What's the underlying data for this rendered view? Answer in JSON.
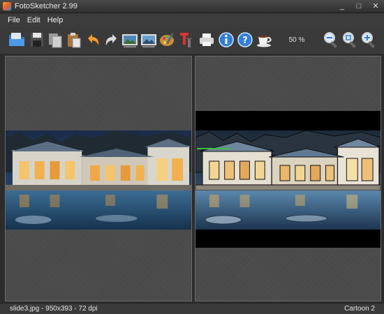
{
  "window": {
    "title": "FotoSketcher 2.99",
    "minimize_glyph": "_",
    "maximize_glyph": "□",
    "close_glyph": "✕"
  },
  "menu": {
    "items": [
      "File",
      "Edit",
      "Help"
    ]
  },
  "toolbar": {
    "buttons": [
      {
        "name": "open-folder-icon"
      },
      {
        "name": "save-disk-icon"
      },
      {
        "name": "copy-icon"
      },
      {
        "name": "paste-icon"
      },
      {
        "name": "undo-icon"
      },
      {
        "name": "redo-icon"
      },
      {
        "name": "original-image-icon"
      },
      {
        "name": "processed-image-icon"
      },
      {
        "name": "paint-palette-icon"
      },
      {
        "name": "text-tool-icon"
      },
      {
        "name": "print-icon"
      },
      {
        "name": "info-icon"
      },
      {
        "name": "help-icon"
      },
      {
        "name": "coffee-cup-icon"
      },
      {
        "name": "zoom-out-icon"
      },
      {
        "name": "zoom-fit-icon"
      },
      {
        "name": "zoom-in-icon"
      }
    ],
    "zoom_level": "50 %"
  },
  "status": {
    "file_info": "slide3.jpg - 950x393 - 72 dpi",
    "effect_name": "Cartoon 2"
  },
  "colors": {
    "accent_orange": "#f29a2e",
    "icon_blue": "#2f7fd8",
    "background": "#3a3a3a"
  }
}
